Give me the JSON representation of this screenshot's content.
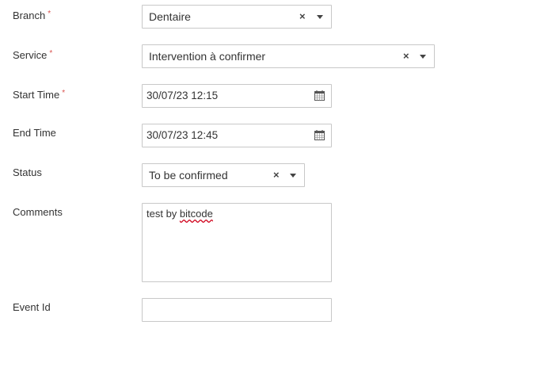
{
  "form": {
    "branch": {
      "label": "Branch",
      "required_mark": "*",
      "value": "Dentaire",
      "clear_glyph": "×"
    },
    "service": {
      "label": "Service",
      "required_mark": "*",
      "value": "Intervention à confirmer",
      "clear_glyph": "×"
    },
    "start_time": {
      "label": "Start Time",
      "required_mark": "*",
      "value": "30/07/23 12:15",
      "icon": "calendar-icon"
    },
    "end_time": {
      "label": "End Time",
      "value": "30/07/23 12:45",
      "icon": "calendar-icon"
    },
    "status": {
      "label": "Status",
      "value": "To be confirmed",
      "clear_glyph": "×"
    },
    "comments": {
      "label": "Comments",
      "value_prefix": "test by ",
      "value_misspelled": "bitcode"
    },
    "event_id": {
      "label": "Event Id",
      "value": ""
    }
  },
  "colors": {
    "required": "#d9534f",
    "border": "#c8c8c8",
    "spellcheck": "#d0021b"
  }
}
